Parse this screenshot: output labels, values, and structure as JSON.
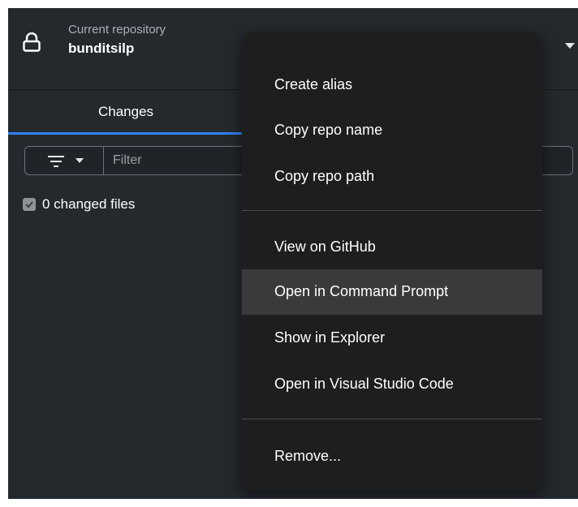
{
  "repository": {
    "caption": "Current repository",
    "name": "bunditsilp"
  },
  "tabs": {
    "changes_label": "Changes"
  },
  "filter": {
    "placeholder": "Filter"
  },
  "changes": {
    "summary": "0 changed files"
  },
  "context_menu": {
    "items": [
      {
        "label": "Create alias"
      },
      {
        "label": "Copy repo name"
      },
      {
        "label": "Copy repo path"
      },
      {
        "label": "View on GitHub"
      },
      {
        "label": "Open in Command Prompt",
        "highlighted": true
      },
      {
        "label": "Show in Explorer"
      },
      {
        "label": "Open in Visual Studio Code"
      },
      {
        "label": "Remove..."
      }
    ]
  },
  "colors": {
    "background": "#24292e",
    "menu_background": "#1e1e1e",
    "menu_highlight": "#3a3a3a",
    "tab_underline": "#2f81f7"
  }
}
